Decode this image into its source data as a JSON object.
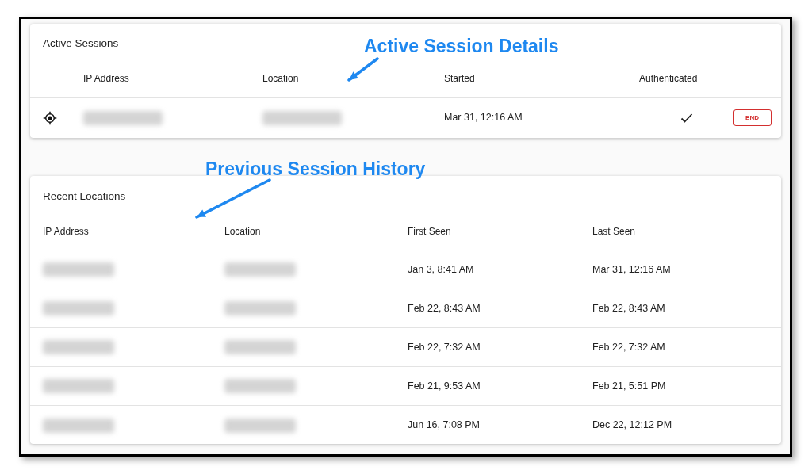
{
  "active_sessions": {
    "title": "Active Sessions",
    "columns": [
      "IP Address",
      "Location",
      "Started",
      "Authenticated"
    ],
    "rows": [
      {
        "started": "Mar 31, 12:16 AM",
        "authenticated": true,
        "action": "END"
      }
    ]
  },
  "recent_locations": {
    "title": "Recent Locations",
    "columns": [
      "IP Address",
      "Location",
      "First Seen",
      "Last Seen"
    ],
    "rows": [
      {
        "first_seen": "Jan 3, 8:41 AM",
        "last_seen": "Mar 31, 12:16 AM"
      },
      {
        "first_seen": "Feb 22, 8:43 AM",
        "last_seen": "Feb 22, 8:43 AM"
      },
      {
        "first_seen": "Feb 22, 7:32 AM",
        "last_seen": "Feb 22, 7:32 AM"
      },
      {
        "first_seen": "Feb 21, 9:53 AM",
        "last_seen": "Feb 21, 5:51 PM"
      },
      {
        "first_seen": "Jun 16, 7:08 PM",
        "last_seen": "Dec 22, 12:12 PM"
      }
    ]
  },
  "annotations": [
    "Active Session Details",
    "Previous Session History"
  ]
}
